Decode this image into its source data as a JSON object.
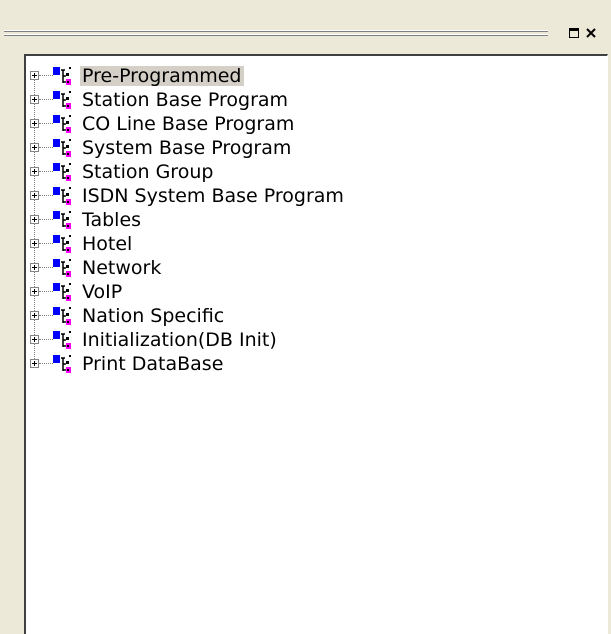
{
  "window": {
    "maximize_icon": "restore-box-icon",
    "close_icon": "close-x-icon"
  },
  "tree": {
    "node_icon": "program-tree-icon",
    "expander_icon": "plus-expand-icon",
    "items": [
      {
        "label": "Pre-Programmed",
        "selected": true
      },
      {
        "label": "Station Base Program"
      },
      {
        "label": "CO Line Base Program"
      },
      {
        "label": "System Base Program"
      },
      {
        "label": "Station Group"
      },
      {
        "label": "ISDN System Base Program"
      },
      {
        "label": "Tables"
      },
      {
        "label": "Hotel"
      },
      {
        "label": "Network"
      },
      {
        "label": "VoIP"
      },
      {
        "label": "Nation Specific"
      },
      {
        "label": "Initialization(DB Init)"
      },
      {
        "label": "Print DataBase"
      }
    ]
  },
  "colors": {
    "selection": "#d4d0c8",
    "panel": "#ece9d8",
    "icon_blue": "#0000ff",
    "icon_magenta": "#ff00ff"
  }
}
